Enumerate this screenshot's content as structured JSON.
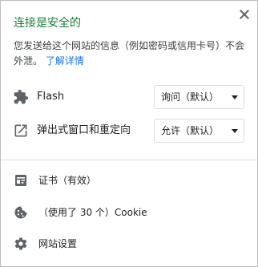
{
  "header": {
    "title": "连接是安全的",
    "close_icon": "close-icon"
  },
  "description": {
    "text": "您发送给这个网站的信息（例如密码或信用卡号）不会外泄。",
    "link": "了解详情"
  },
  "permissions": [
    {
      "icon": "puzzle-icon",
      "label": "Flash",
      "value": "询问（默认）"
    },
    {
      "icon": "open-in-new-icon",
      "label": "弹出式窗口和重定向",
      "value": "允许（默认）"
    }
  ],
  "links": [
    {
      "icon": "certificate-icon",
      "label": "证书（有效）"
    },
    {
      "icon": "cookie-icon",
      "label": "（使用了 30 个）Cookie"
    },
    {
      "icon": "gear-icon",
      "label": "网站设置"
    }
  ],
  "colors": {
    "title_green": "#188038",
    "link_blue": "#1a73e8",
    "icon_gray": "#5f6368",
    "border": "#bdbdbd"
  }
}
